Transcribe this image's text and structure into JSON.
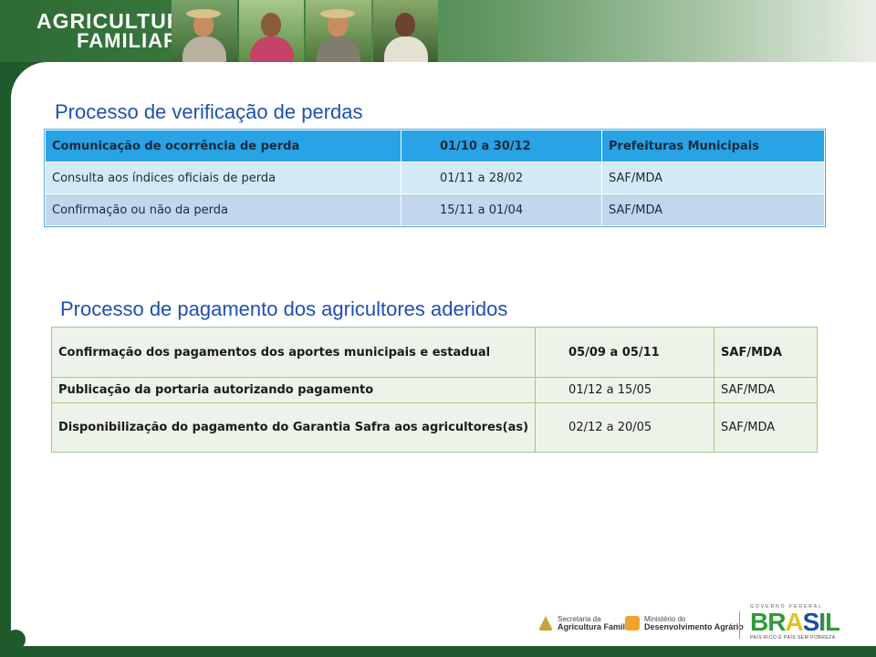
{
  "header": {
    "brand_line1": "AGRICULTURA",
    "brand_line2": "FAMILIAR"
  },
  "section1": {
    "title": "Processo de verificação de perdas",
    "rows": [
      {
        "step": "Comunicação de ocorrência de perda",
        "period": "01/10 a 30/12",
        "responsible": "Prefeituras Municipais"
      },
      {
        "step": "Consulta aos índices oficiais de perda",
        "period": "01/11 a 28/02",
        "responsible": "SAF/MDA"
      },
      {
        "step": "Confirmação ou não da perda",
        "period": "15/11 a 01/04",
        "responsible": "SAF/MDA"
      }
    ]
  },
  "section2": {
    "title": "Processo de pagamento dos agricultores aderidos",
    "rows": [
      {
        "step": "Confirmação dos pagamentos dos aportes municipais e estadual",
        "period": "05/09 a 05/11",
        "responsible": "SAF/MDA"
      },
      {
        "step": "Publicação da portaria autorizando pagamento",
        "period": "01/12 a 15/05",
        "responsible": "SAF/MDA"
      },
      {
        "step": "Disponibilização do pagamento do Garantia Safra aos agricultores(as)",
        "period": "02/12 a 20/05",
        "responsible": "SAF/MDA"
      }
    ]
  },
  "footer": {
    "saf_line1": "Secretaria da",
    "saf_line2": "Agricultura Familiar",
    "mda_line1": "Ministério do",
    "mda_line2": "Desenvolvimento Agrário",
    "gov_label": "GOVERNO FEDERAL",
    "brasil_word": "BRASIL",
    "slogan": "PAÍS RICO É PAÍS SEM POBREZA"
  },
  "colors": {
    "title_blue": "#1f4fb2",
    "table1_header": "#27a3e6",
    "table2_border": "#9fca7e",
    "frame_green": "#1f5a2c"
  }
}
